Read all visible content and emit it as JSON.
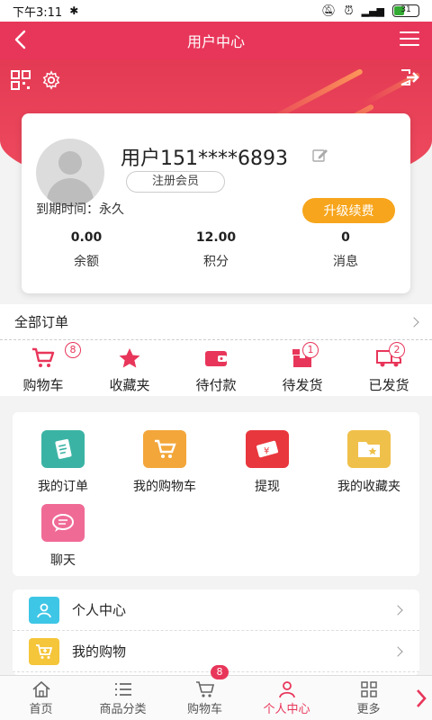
{
  "status_bar": {
    "time": "下午3:11",
    "battery": "31"
  },
  "header": {
    "title": "用户中心"
  },
  "profile": {
    "username": "用户151****6893",
    "member_badge": "注册会员",
    "expire_text": "到期时间：永久",
    "upgrade_button": "升级续费"
  },
  "stats": [
    {
      "value": "0.00",
      "label": "余额"
    },
    {
      "value": "12.00",
      "label": "积分"
    },
    {
      "value": "0",
      "label": "消息"
    }
  ],
  "orders": {
    "label": "全部订单"
  },
  "order_status": [
    {
      "label": "购物车",
      "badge": "8",
      "icon": "cart-icon"
    },
    {
      "label": "收藏夹",
      "badge": "",
      "icon": "star-icon"
    },
    {
      "label": "待付款",
      "badge": "",
      "icon": "wallet-icon"
    },
    {
      "label": "待发货",
      "badge": "1",
      "icon": "box-icon"
    },
    {
      "label": "已发货",
      "badge": "2",
      "icon": "truck-icon"
    }
  ],
  "grid": [
    {
      "label": "我的订单",
      "icon": "order-list-icon",
      "color": "#3bb3a4"
    },
    {
      "label": "我的购物车",
      "icon": "cart-icon",
      "color": "#f3a63a"
    },
    {
      "label": "提现",
      "icon": "cash-icon",
      "color": "#e8373d"
    },
    {
      "label": "我的收藏夹",
      "icon": "folder-star-icon",
      "color": "#efc04a"
    },
    {
      "label": "聊天",
      "icon": "chat-icon",
      "color": "#f06a96"
    }
  ],
  "list": [
    {
      "label": "个人中心",
      "icon": "user-icon",
      "color": "#3ec6e6"
    },
    {
      "label": "我的购物",
      "icon": "cart-add-icon",
      "color": "#f5c53a"
    }
  ],
  "tabbar": [
    {
      "label": "首页",
      "icon": "home-icon"
    },
    {
      "label": "商品分类",
      "icon": "list-icon"
    },
    {
      "label": "购物车",
      "icon": "cart-icon",
      "badge": "8"
    },
    {
      "label": "个人中心",
      "icon": "user-icon"
    },
    {
      "label": "更多",
      "icon": "grid-icon"
    }
  ],
  "colors": {
    "brand": "#e8365a",
    "accent": "#f7a51c"
  }
}
